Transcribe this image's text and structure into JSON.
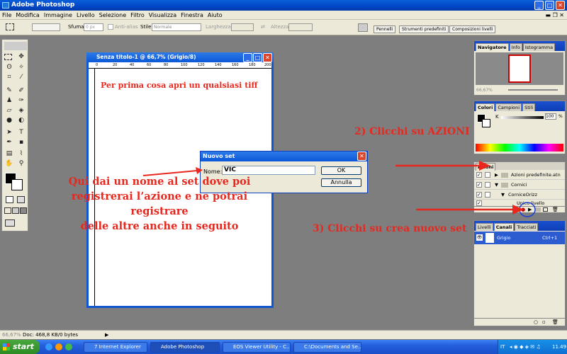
{
  "app": {
    "title": "Adobe Photoshop"
  },
  "menu": [
    "File",
    "Modifica",
    "Immagine",
    "Livello",
    "Selezione",
    "Filtro",
    "Visualizza",
    "Finestra",
    "Aiuto"
  ],
  "options": {
    "sfuma_label": "Sfuma:",
    "sfuma_value": "0 px",
    "antialias_label": "Anti-alias",
    "stile_label": "Stile:",
    "stile_value": "Normale",
    "larghezza_label": "Larghezza:",
    "altezza_label": "Altezza:",
    "palette_tabs": [
      "Pennelli",
      "Strumenti predefiniti",
      "Composizioni livelli"
    ]
  },
  "document": {
    "title": "Senza titolo-1 @ 66,7% (Grigio/8)",
    "ruler_marks": [
      "0",
      "20",
      "40",
      "60",
      "80",
      "100",
      "120",
      "140",
      "160",
      "180",
      "200"
    ]
  },
  "dialog": {
    "title": "Nuovo set",
    "name_label": "Nome:",
    "name_value": "VIC",
    "ok_label": "OK",
    "cancel_label": "Annulla"
  },
  "navigator": {
    "tabs": [
      "Navigatore",
      "Info",
      "Istogramma"
    ],
    "zoom": "66,67%"
  },
  "colors": {
    "tabs": [
      "Colori",
      "Campioni",
      "Stili"
    ],
    "k_label": "K",
    "k_value": "100",
    "k_unit": "%"
  },
  "actions": {
    "tabs": [
      "Azioni"
    ],
    "items": [
      {
        "label": "Azioni predefinite.atn"
      },
      {
        "label": "Cornici"
      },
      {
        "label": "CorniceOrizz"
      },
      {
        "label": "Unico livello"
      }
    ]
  },
  "layers": {
    "tabs": [
      "Livelli",
      "Canali",
      "Tracciati"
    ],
    "channel_name": "Grigio",
    "channel_shortcut": "Ctrl+1"
  },
  "annotations": {
    "first": "Per prima cosa apri un qualsiasi tiff",
    "step2": "2) Clicchi su AZIONI",
    "step3": "3) Clicchi su crea nuovo set",
    "name_note_1": "Qui dai un nome al set dove poi",
    "name_note_2": "registrerai l’azione e ne potrai registrare",
    "name_note_3": "delle altre anche in seguito"
  },
  "status": {
    "zoom": "66,67%",
    "doc": "Doc: 468,8 KB/0 bytes"
  },
  "taskbar": {
    "start": "start",
    "tasks": [
      "7 Internet Explorer",
      "Adobe Photoshop",
      "EOS Viewer Utility - C...",
      "C:\\Documents and Se..."
    ],
    "lang": "IT",
    "time": "11.49"
  }
}
